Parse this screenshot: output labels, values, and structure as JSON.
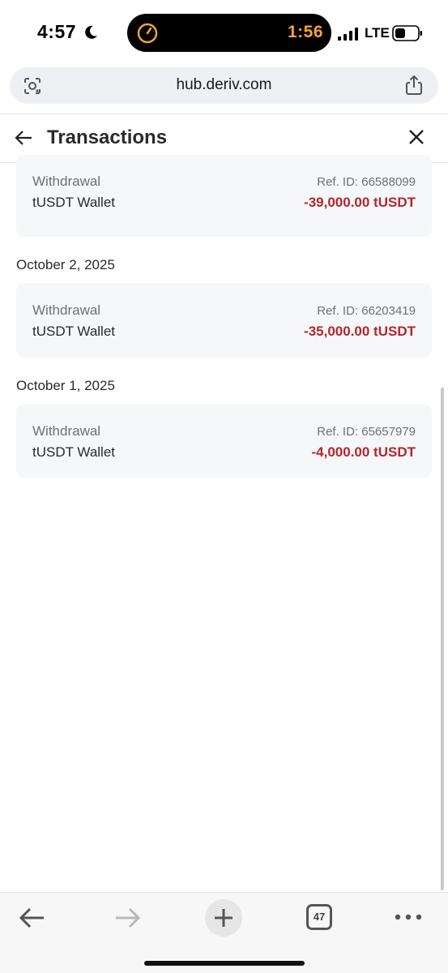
{
  "status_bar": {
    "time": "4:57",
    "timer": "1:56",
    "network": "LTE",
    "icons": [
      "moon-icon",
      "timer-icon",
      "signal-icon",
      "battery-icon"
    ]
  },
  "browser": {
    "url": "hub.deriv.com",
    "tab_count": "47"
  },
  "header": {
    "title": "Transactions"
  },
  "transactions": [
    {
      "date": "",
      "type": "Withdrawal",
      "wallet": "tUSDT Wallet",
      "ref": "Ref. ID: 66588099",
      "amount": "-39,000.00 tUSDT"
    },
    {
      "date": "October 2, 2025",
      "type": "Withdrawal",
      "wallet": "tUSDT Wallet",
      "ref": "Ref. ID: 66203419",
      "amount": "-35,000.00 tUSDT"
    },
    {
      "date": "October 1, 2025",
      "type": "Withdrawal",
      "wallet": "tUSDT Wallet",
      "ref": "Ref. ID: 65657979",
      "amount": "-4,000.00 tUSDT"
    }
  ],
  "colors": {
    "amount_negative": "#b3262c",
    "card_background": "#f6f7f9",
    "timer_accent": "#f2a33a"
  }
}
